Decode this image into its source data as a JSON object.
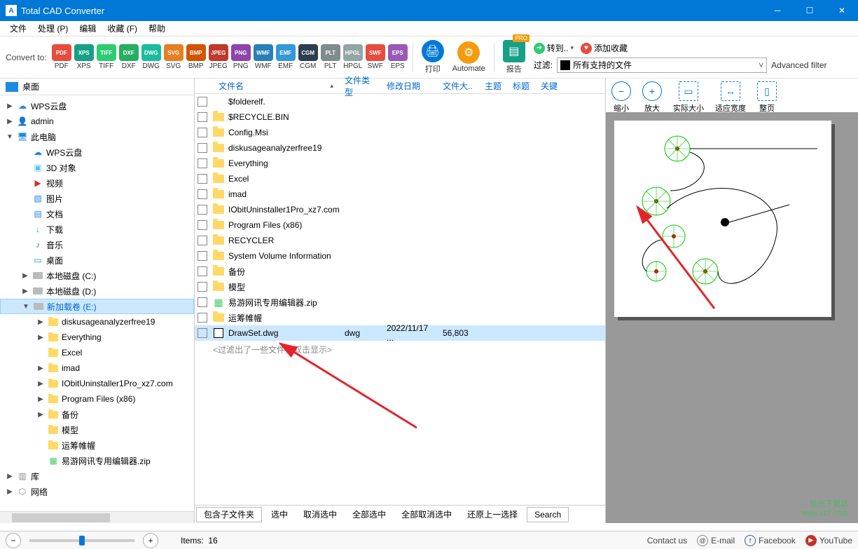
{
  "app": {
    "title": "Total CAD Converter",
    "icon_letter": "A"
  },
  "menu": [
    "文件",
    "处理 (P)",
    "编辑",
    "收藏 (F)",
    "帮助"
  ],
  "toolbar": {
    "convert_label": "Convert to:",
    "formats": [
      {
        "code": "PDF",
        "color": "ic-pdf"
      },
      {
        "code": "XPS",
        "color": "ic-xps"
      },
      {
        "code": "TIFF",
        "color": "ic-tiff"
      },
      {
        "code": "DXF",
        "color": "ic-dxf"
      },
      {
        "code": "DWG",
        "color": "ic-dwg"
      },
      {
        "code": "SVG",
        "color": "ic-svg"
      },
      {
        "code": "BMP",
        "color": "ic-bmp"
      },
      {
        "code": "JPEG",
        "color": "ic-jpeg"
      },
      {
        "code": "PNG",
        "color": "ic-png"
      },
      {
        "code": "WMF",
        "color": "ic-wmf"
      },
      {
        "code": "EMF",
        "color": "ic-emf"
      },
      {
        "code": "CGM",
        "color": "ic-cgm"
      },
      {
        "code": "PLT",
        "color": "ic-plt"
      },
      {
        "code": "HPGL",
        "color": "ic-hpgl"
      },
      {
        "code": "SWF",
        "color": "ic-swf"
      },
      {
        "code": "EPS",
        "color": "ic-eps"
      }
    ],
    "print": "打印",
    "automate": "Automate",
    "report": "报告",
    "pro_badge": "PRO",
    "links": {
      "goto": "转到..",
      "fav": "添加收藏"
    },
    "filter_label": "过滤:",
    "filter_value": "所有支持的文件",
    "advanced_filter": "Advanced filter"
  },
  "tree": {
    "root": "桌面",
    "nodes": [
      {
        "indent": 0,
        "twisty": "▶",
        "icon": "cloud",
        "label": "WPS云盘"
      },
      {
        "indent": 0,
        "twisty": "▶",
        "icon": "user",
        "label": "admin"
      },
      {
        "indent": 0,
        "twisty": "▼",
        "icon": "pc",
        "label": "此电脑"
      },
      {
        "indent": 1,
        "twisty": "",
        "icon": "cloud",
        "label": "WPS云盘"
      },
      {
        "indent": 1,
        "twisty": "",
        "icon": "obj",
        "label": "3D 对象"
      },
      {
        "indent": 1,
        "twisty": "",
        "icon": "video",
        "label": "视频"
      },
      {
        "indent": 1,
        "twisty": "",
        "icon": "pic",
        "label": "图片"
      },
      {
        "indent": 1,
        "twisty": "",
        "icon": "doc",
        "label": "文档"
      },
      {
        "indent": 1,
        "twisty": "",
        "icon": "dl",
        "label": "下载"
      },
      {
        "indent": 1,
        "twisty": "",
        "icon": "music",
        "label": "音乐"
      },
      {
        "indent": 1,
        "twisty": "",
        "icon": "desk",
        "label": "桌面"
      },
      {
        "indent": 1,
        "twisty": "▶",
        "icon": "disk",
        "label": "本地磁盘 (C:)"
      },
      {
        "indent": 1,
        "twisty": "▶",
        "icon": "disk",
        "label": "本地磁盘 (D:)"
      },
      {
        "indent": 1,
        "twisty": "▼",
        "icon": "disk",
        "label": "新加载卷 (E:)",
        "selected": true
      },
      {
        "indent": 2,
        "twisty": "▶",
        "icon": "folder",
        "label": "diskusageanalyzerfree19"
      },
      {
        "indent": 2,
        "twisty": "▶",
        "icon": "folder",
        "label": "Everything"
      },
      {
        "indent": 2,
        "twisty": "",
        "icon": "folder",
        "label": "Excel"
      },
      {
        "indent": 2,
        "twisty": "▶",
        "icon": "folder",
        "label": "imad"
      },
      {
        "indent": 2,
        "twisty": "▶",
        "icon": "folder",
        "label": "IObitUninstaller1Pro_xz7.com"
      },
      {
        "indent": 2,
        "twisty": "▶",
        "icon": "folder",
        "label": "Program Files (x86)"
      },
      {
        "indent": 2,
        "twisty": "▶",
        "icon": "folder",
        "label": "备份"
      },
      {
        "indent": 2,
        "twisty": "",
        "icon": "folder",
        "label": "模型"
      },
      {
        "indent": 2,
        "twisty": "",
        "icon": "folder",
        "label": "运筹帷幄"
      },
      {
        "indent": 2,
        "twisty": "",
        "icon": "zip",
        "label": "易游网讯专用编辑器.zip"
      },
      {
        "indent": 0,
        "twisty": "▶",
        "icon": "lib",
        "label": "库"
      },
      {
        "indent": 0,
        "twisty": "▶",
        "icon": "net",
        "label": "网络"
      }
    ]
  },
  "filelist": {
    "headers": {
      "name": "文件名",
      "type": "文件类型",
      "date": "修改日期",
      "size": "文件大..",
      "topic": "主题",
      "title": "标题",
      "key": "关键"
    },
    "rows": [
      {
        "icon": "none",
        "name": "$folderelf."
      },
      {
        "icon": "folder",
        "name": "$RECYCLE.BIN"
      },
      {
        "icon": "folder",
        "name": "Config.Msi"
      },
      {
        "icon": "folder",
        "name": "diskusageanalyzerfree19"
      },
      {
        "icon": "folder",
        "name": "Everything"
      },
      {
        "icon": "folder",
        "name": "Excel"
      },
      {
        "icon": "folder",
        "name": "imad"
      },
      {
        "icon": "folder",
        "name": "IObitUninstaller1Pro_xz7.com"
      },
      {
        "icon": "folder",
        "name": "Program Files (x86)"
      },
      {
        "icon": "folder",
        "name": "RECYCLER"
      },
      {
        "icon": "folder",
        "name": "System Volume Information"
      },
      {
        "icon": "folder",
        "name": "备份"
      },
      {
        "icon": "folder",
        "name": "模型"
      },
      {
        "icon": "zip",
        "name": "易游网讯专用编辑器.zip"
      },
      {
        "icon": "folder",
        "name": "运筹帷幄"
      },
      {
        "icon": "dwg",
        "name": "DrawSet.dwg",
        "type": "dwg",
        "date": "2022/11/17 ...",
        "size": "56,803",
        "selected": true
      }
    ],
    "filtered_msg": "<过滤出了一些文件，双击显示>",
    "bottom": {
      "subfolders": "包含子文件夹",
      "check": "选中",
      "uncheck": "取消选中",
      "checkall": "全部选中",
      "uncheckall": "全部取消选中",
      "restore": "还原上一选择",
      "search": "Search"
    }
  },
  "preview": {
    "buttons": {
      "zoomout": "缩小",
      "zoomin": "放大",
      "actual": "实际大小",
      "fitwidth": "适应宽度",
      "fitpage": "整页"
    },
    "watermark": "极光下载站\nwww.xz7.com"
  },
  "status": {
    "items_label": "Items:",
    "items_count": "16",
    "contact": "Contact us",
    "email": "E-mail",
    "facebook": "Facebook",
    "youtube": "YouTube"
  }
}
